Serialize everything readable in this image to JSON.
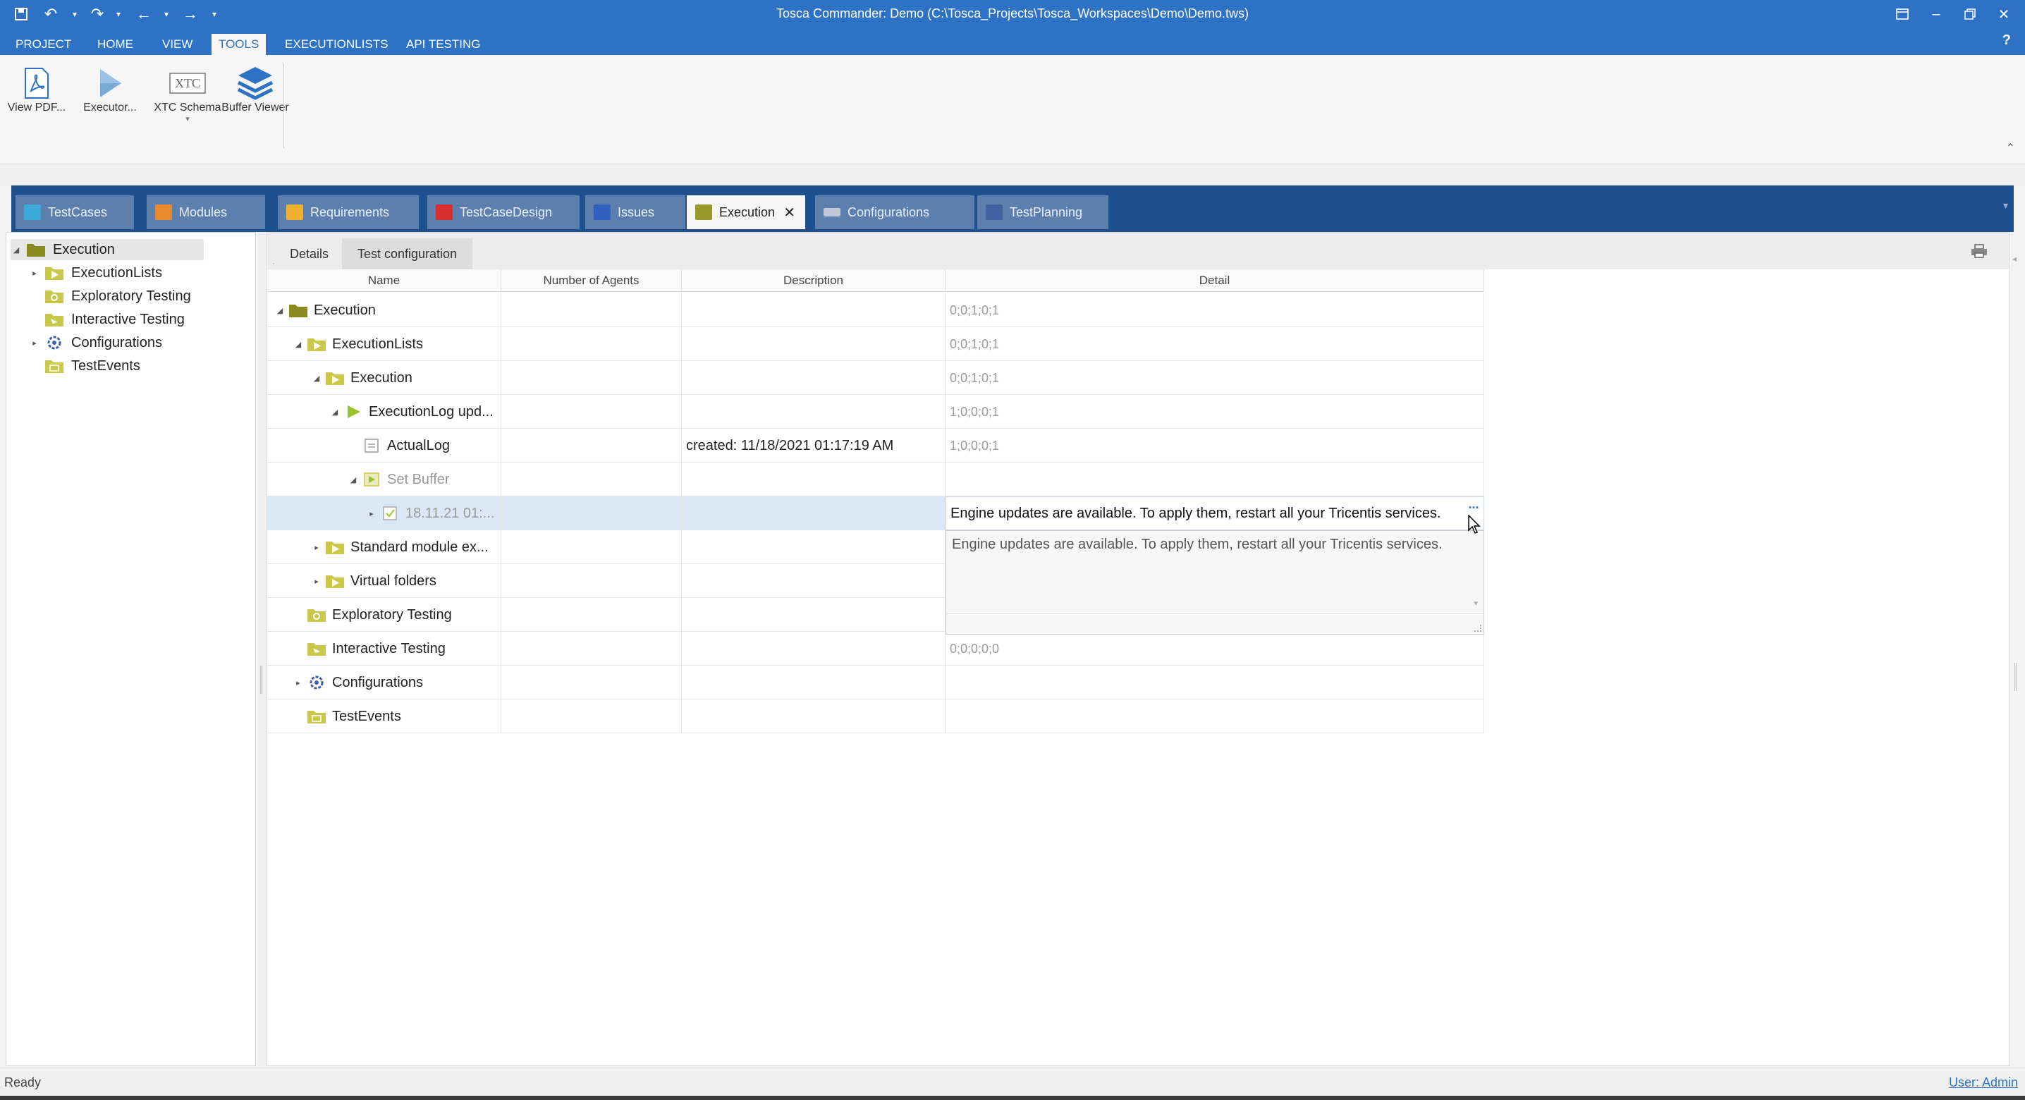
{
  "window": {
    "title": "Tosca Commander: Demo (C:\\Tosca_Projects\\Tosca_Workspaces\\Demo\\Demo.tws)",
    "accent_color": "#2d72c4"
  },
  "quick_access": {
    "icons": [
      "save-icon",
      "undo-icon",
      "redo-icon",
      "back-icon",
      "forward-icon"
    ]
  },
  "menu": {
    "tabs": [
      {
        "label": "PROJECT"
      },
      {
        "label": "HOME"
      },
      {
        "label": "VIEW"
      },
      {
        "label": "TOOLS",
        "active": true
      },
      {
        "label": "EXECUTIONLISTS"
      },
      {
        "label": "API TESTING"
      }
    ],
    "help": "?"
  },
  "ribbon": {
    "buttons": [
      {
        "label": "View PDF...",
        "icon": "pdf-icon"
      },
      {
        "label": "Executor...",
        "icon": "executor-icon"
      },
      {
        "label": "XTC Schema",
        "icon": "xtc-icon"
      },
      {
        "label": "Buffer Viewer",
        "icon": "buffer-stack-icon"
      }
    ],
    "xtc_icon_text": "XTC"
  },
  "section_tabs": [
    {
      "label": "TestCases",
      "color": "#3da9d8"
    },
    {
      "label": "Modules",
      "color": "#e88a30"
    },
    {
      "label": "Requirements",
      "color": "#f0b030"
    },
    {
      "label": "TestCaseDesign",
      "color": "#d83030"
    },
    {
      "label": "Issues",
      "color": "#3060c0"
    },
    {
      "label": "Execution",
      "color": "#9a9a2a",
      "active": true,
      "close": "✕"
    },
    {
      "label": "Configurations",
      "color": "#c0c8d8"
    },
    {
      "label": "TestPlanning",
      "color": "#4060a0"
    }
  ],
  "left_tree": {
    "items": [
      {
        "label": "Execution",
        "expanded": true
      },
      {
        "label": "ExecutionLists"
      },
      {
        "label": "Exploratory Testing"
      },
      {
        "label": "Interactive Testing"
      },
      {
        "label": "Configurations"
      },
      {
        "label": "TestEvents"
      }
    ]
  },
  "main": {
    "tabs": [
      {
        "label": "Details",
        "active": true
      },
      {
        "label": "Test configuration"
      }
    ],
    "columns": {
      "name": "Name",
      "agents": "Number of Agents",
      "description": "Description",
      "detail": "Detail"
    },
    "rows": [
      {
        "name": "Execution",
        "description": "",
        "detail": "0;0;1;0;1"
      },
      {
        "name": "ExecutionLists",
        "description": "",
        "detail": "0;0;1;0;1"
      },
      {
        "name": "Execution",
        "description": "",
        "detail": "0;0;1;0;1"
      },
      {
        "name": "ExecutionLog upd...",
        "description": "",
        "detail": "1;0;0;0;1"
      },
      {
        "name": "ActualLog",
        "description": "created: 11/18/2021 01:17:19 AM",
        "detail": "1;0;0;0;1"
      },
      {
        "name": "Set Buffer",
        "description": "",
        "detail": ""
      },
      {
        "name": "18.11.21 01:...",
        "description": "",
        "detail": ""
      },
      {
        "name": "Standard module ex...",
        "description": "",
        "detail": ""
      },
      {
        "name": "Virtual folders",
        "description": "",
        "detail": ""
      },
      {
        "name": "Exploratory Testing",
        "description": "",
        "detail": ""
      },
      {
        "name": "Interactive Testing",
        "description": "",
        "detail": "0;0;0;0;0"
      },
      {
        "name": "Configurations",
        "description": "",
        "detail": ""
      },
      {
        "name": "TestEvents",
        "description": "",
        "detail": ""
      }
    ],
    "detail_editor": {
      "value": "Engine updates are available. To apply them, restart all your Tricentis services.",
      "button": "...",
      "dropdown_text": "Engine updates are available. To apply them, restart all your Tricentis services."
    }
  },
  "status": {
    "text": "Ready",
    "user": "User: Admin"
  }
}
